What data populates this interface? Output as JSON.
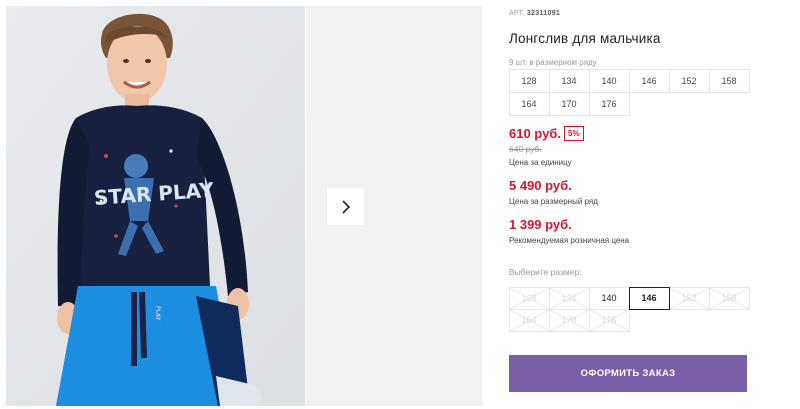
{
  "product": {
    "art_label": "АРТ.",
    "art_number": "32311091",
    "title": "Лонгслив для мальчика"
  },
  "size_set": {
    "note": "9 шт. в размерном ряду",
    "sizes": [
      "128",
      "134",
      "140",
      "146",
      "152",
      "158",
      "164",
      "170",
      "176"
    ]
  },
  "prices": {
    "unit_price": "610 руб.",
    "discount": "5%",
    "old_price": "640 руб.",
    "unit_caption": "Цена за единицу",
    "set_price": "5 490 руб.",
    "set_caption": "Цена за размерный ряд",
    "rrp_price": "1 399 руб.",
    "rrp_caption": "Рекомендуемая розничная цена"
  },
  "size_picker": {
    "label": "Выберите размер:",
    "options": [
      {
        "label": "128",
        "available": false,
        "selected": false
      },
      {
        "label": "134",
        "available": false,
        "selected": false
      },
      {
        "label": "140",
        "available": true,
        "selected": false
      },
      {
        "label": "146",
        "available": true,
        "selected": true
      },
      {
        "label": "152",
        "available": false,
        "selected": false
      },
      {
        "label": "158",
        "available": false,
        "selected": false
      },
      {
        "label": "164",
        "available": false,
        "selected": false
      },
      {
        "label": "170",
        "available": false,
        "selected": false
      },
      {
        "label": "176",
        "available": false,
        "selected": false
      }
    ]
  },
  "order_button": "ОФОРМИТЬ ЗАКАЗ",
  "gallery": {
    "next_icon": "chevron-right-icon",
    "print_text": "STAR PLAY",
    "drawstring_text": "PLAY"
  },
  "colors": {
    "accent_price": "#d5162d",
    "order_button": "#7a5ea8",
    "shirt": "#17213f",
    "pants": "#1c8fe0"
  }
}
